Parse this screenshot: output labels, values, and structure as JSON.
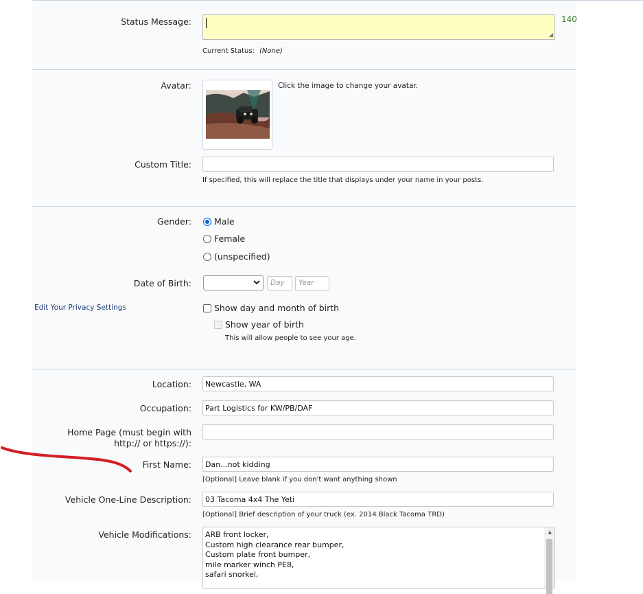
{
  "status": {
    "label": "Status Message:",
    "char_count": "140",
    "current_label": "Current Status:",
    "current_value": "(None)"
  },
  "avatar": {
    "label": "Avatar:",
    "hint": "Click the image to change your avatar."
  },
  "custom_title": {
    "label": "Custom Title:",
    "value": "",
    "desc": "If specified, this will replace the title that displays under your name in your posts."
  },
  "gender": {
    "label": "Gender:",
    "options": [
      "Male",
      "Female",
      "(unspecified)"
    ],
    "selected": "Male"
  },
  "dob": {
    "label": "Date of Birth:",
    "month_value": "",
    "day_placeholder": "Day",
    "year_placeholder": "Year"
  },
  "privacy": {
    "link": "Edit Your Privacy Settings",
    "show_day_month": "Show day and month of birth",
    "show_year": "Show year of birth",
    "year_desc": "This will allow people to see your age."
  },
  "location": {
    "label": "Location:",
    "value": "Newcastle, WA"
  },
  "occupation": {
    "label": "Occupation:",
    "value": "Part Logistics for KW/PB/DAF"
  },
  "homepage": {
    "label": "Home Page (must begin with http:// or https://):",
    "value": ""
  },
  "first_name": {
    "label": "First Name:",
    "value": "Dan...not kidding",
    "desc": "[Optional] Leave blank if you don't want anything shown"
  },
  "vehicle_desc": {
    "label": "Vehicle One-Line Description:",
    "value": "03 Tacoma 4x4 The Yeti",
    "desc": "[Optional] Brief description of your truck (ex. 2014 Black Tacoma TRD)"
  },
  "vehicle_mods": {
    "label": "Vehicle Modifications:",
    "lines": [
      "ARB front locker,",
      "Custom high clearance rear bumper,",
      "Custom plate front bumper,",
      "mile marker winch PE8,",
      "safari snorkel,"
    ]
  },
  "colors": {
    "status_bg": "#ffffc3",
    "count_green": "#3a7f1f",
    "link_blue": "#1f3e76",
    "radio_blue": "#0b62d6",
    "annotation_red": "#d31f26"
  }
}
